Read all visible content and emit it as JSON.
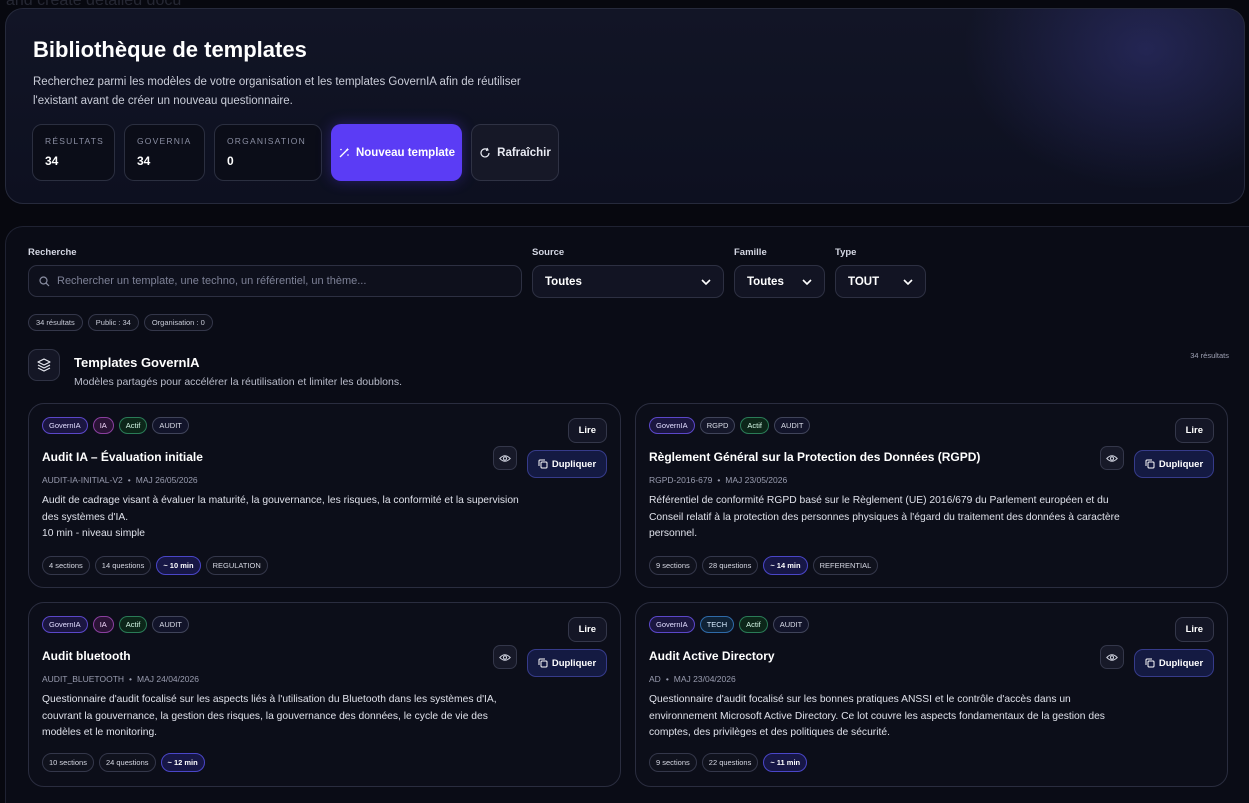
{
  "hero": {
    "title": "Bibliothèque de templates",
    "description": "Recherchez parmi les modèles de votre organisation et les templates GovernIA afin de réutiliser l'existant avant de créer un nouveau questionnaire.",
    "stats": [
      {
        "label": "RÉSULTATS",
        "value": "34"
      },
      {
        "label": "GOVERNIA",
        "value": "34"
      },
      {
        "label": "ORGANISATION",
        "value": "0"
      }
    ],
    "new_template_label": "Nouveau template",
    "refresh_label": "Rafraîchir"
  },
  "filters": {
    "search_label": "Recherche",
    "search_placeholder": "Rechercher un template, une techno, un référentiel, un thème...",
    "source_label": "Source",
    "source_value": "Toutes",
    "famille_label": "Famille",
    "famille_value": "Toutes",
    "type_label": "Type",
    "type_value": "TOUT"
  },
  "summary_chips": [
    "34 résultats",
    "Public : 34",
    "Organisation : 0"
  ],
  "section": {
    "title": "Templates GovernIA",
    "subtitle": "Modèles partagés pour accélérer la réutilisation et limiter les doublons.",
    "count": "34 résultats"
  },
  "cards": [
    {
      "tags": [
        "GovernIA",
        "IA",
        "Actif",
        "AUDIT"
      ],
      "tag_styles": [
        "govern",
        "ia",
        "actif",
        "audit"
      ],
      "read_label": "Lire",
      "duplicate_label": "Dupliquer",
      "title": "Audit IA – Évaluation initiale",
      "code": "AUDIT-IA-INITIAL-V2",
      "updated": "MAJ 26/05/2026",
      "description": "Audit de cadrage visant à évaluer la maturité, la gouvernance, les risques, la conformité et la supervision des systèmes d'IA.\n10 min - niveau simple",
      "pills": [
        "4 sections",
        "14 questions",
        "~ 10 min",
        "REGULATION"
      ]
    },
    {
      "tags": [
        "GovernIA",
        "RGPD",
        "Actif",
        "AUDIT"
      ],
      "tag_styles": [
        "govern",
        "rgpd",
        "actif",
        "audit"
      ],
      "read_label": "Lire",
      "duplicate_label": "Dupliquer",
      "title": "Règlement Général sur la Protection des Données (RGPD)",
      "code": "RGPD-2016-679",
      "updated": "MAJ 23/05/2026",
      "description": "Référentiel de conformité RGPD basé sur le Règlement (UE) 2016/679 du Parlement européen et du Conseil relatif à la protection des personnes physiques à l'égard du traitement des données à caractère personnel.",
      "pills": [
        "9 sections",
        "28 questions",
        "~ 14 min",
        "REFERENTIAL"
      ]
    },
    {
      "tags": [
        "GovernIA",
        "IA",
        "Actif",
        "AUDIT"
      ],
      "tag_styles": [
        "govern",
        "ia",
        "actif",
        "audit"
      ],
      "read_label": "Lire",
      "duplicate_label": "Dupliquer",
      "title": "Audit bluetooth",
      "code": "AUDIT_BLUETOOTH",
      "updated": "MAJ 24/04/2026",
      "description": "Questionnaire d'audit focalisé sur les aspects liés à l'utilisation du Bluetooth dans les systèmes d'IA, couvrant la gouvernance, la gestion des risques, la gouvernance des données, le cycle de vie des modèles et le monitoring.",
      "pills": [
        "10 sections",
        "24 questions",
        "~ 12 min"
      ]
    },
    {
      "tags": [
        "GovernIA",
        "TECH",
        "Actif",
        "AUDIT"
      ],
      "tag_styles": [
        "govern",
        "tech",
        "actif",
        "audit"
      ],
      "read_label": "Lire",
      "duplicate_label": "Dupliquer",
      "title": "Audit Active Directory",
      "code": "AD",
      "updated": "MAJ 23/04/2026",
      "description": "Questionnaire d'audit focalisé sur les bonnes pratiques ANSSI et le contrôle d'accès dans un environnement Microsoft Active Directory. Ce lot couvre les aspects fondamentaux de la gestion des comptes, des privilèges et des politiques de sécurité.",
      "pills": [
        "9 sections",
        "22 questions",
        "~ 11 min"
      ]
    }
  ],
  "colors": {
    "accent": "#5b3cf5",
    "background": "#07080f",
    "card": "#0c0e19"
  }
}
